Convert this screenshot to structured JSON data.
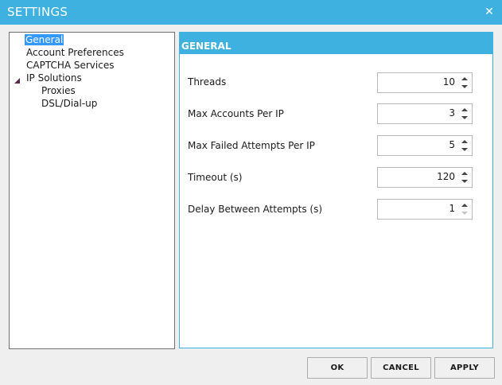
{
  "window": {
    "title": "SETTINGS",
    "close_glyph": "✕"
  },
  "tree": {
    "items": [
      {
        "label": "General",
        "selected": true
      },
      {
        "label": "Account Preferences"
      },
      {
        "label": "CAPTCHA Services"
      },
      {
        "label": "IP Solutions",
        "expanded": true
      },
      {
        "label": "Proxies"
      },
      {
        "label": "DSL/Dial-up"
      }
    ]
  },
  "panel": {
    "header": "GENERAL",
    "fields": [
      {
        "label": "Threads",
        "value": "10"
      },
      {
        "label": "Max Accounts Per IP",
        "value": "3"
      },
      {
        "label": "Max Failed Attempts Per IP",
        "value": "5"
      },
      {
        "label": "Timeout (s)",
        "value": "120"
      },
      {
        "label": "Delay Between Attempts (s)",
        "value": "1"
      }
    ]
  },
  "buttons": {
    "ok": "OK",
    "cancel": "CANCEL",
    "apply": "APPLY"
  },
  "colors": {
    "accent": "#3eb1e0",
    "selection": "#3399ff"
  }
}
